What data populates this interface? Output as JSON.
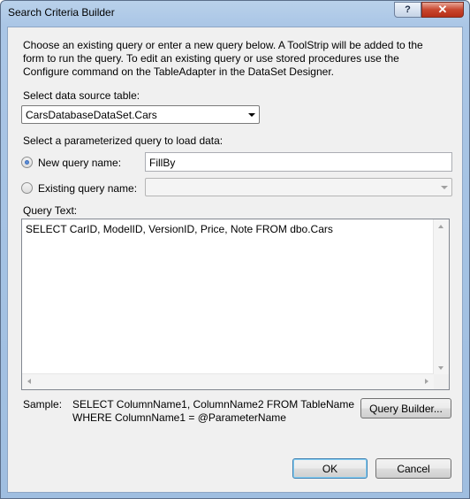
{
  "window": {
    "title": "Search Criteria Builder",
    "help_glyph": "?",
    "close_glyph": "✕"
  },
  "description": "Choose an existing query or enter a new query below. A ToolStrip will be added to the form to run the query. To edit an existing query or use stored procedures use the Configure command on the TableAdapter in the DataSet Designer.",
  "data_source": {
    "label": "Select data source table:",
    "selected": "CarsDatabaseDataSet.Cars"
  },
  "param_query": {
    "label": "Select a parameterized query to load data:",
    "new_query": {
      "label": "New query name:",
      "value": "FillBy",
      "selected": true
    },
    "existing_query": {
      "label": "Existing query name:",
      "value": "",
      "selected": false
    }
  },
  "query_text": {
    "label": "Query Text:",
    "value": "SELECT CarID, ModelID, VersionID, Price, Note FROM dbo.Cars"
  },
  "sample": {
    "label": "Sample:",
    "line1": "SELECT ColumnName1, ColumnName2 FROM TableName",
    "line2": "WHERE ColumnName1 = @ParameterName"
  },
  "buttons": {
    "query_builder": "Query Builder...",
    "ok": "OK",
    "cancel": "Cancel"
  }
}
